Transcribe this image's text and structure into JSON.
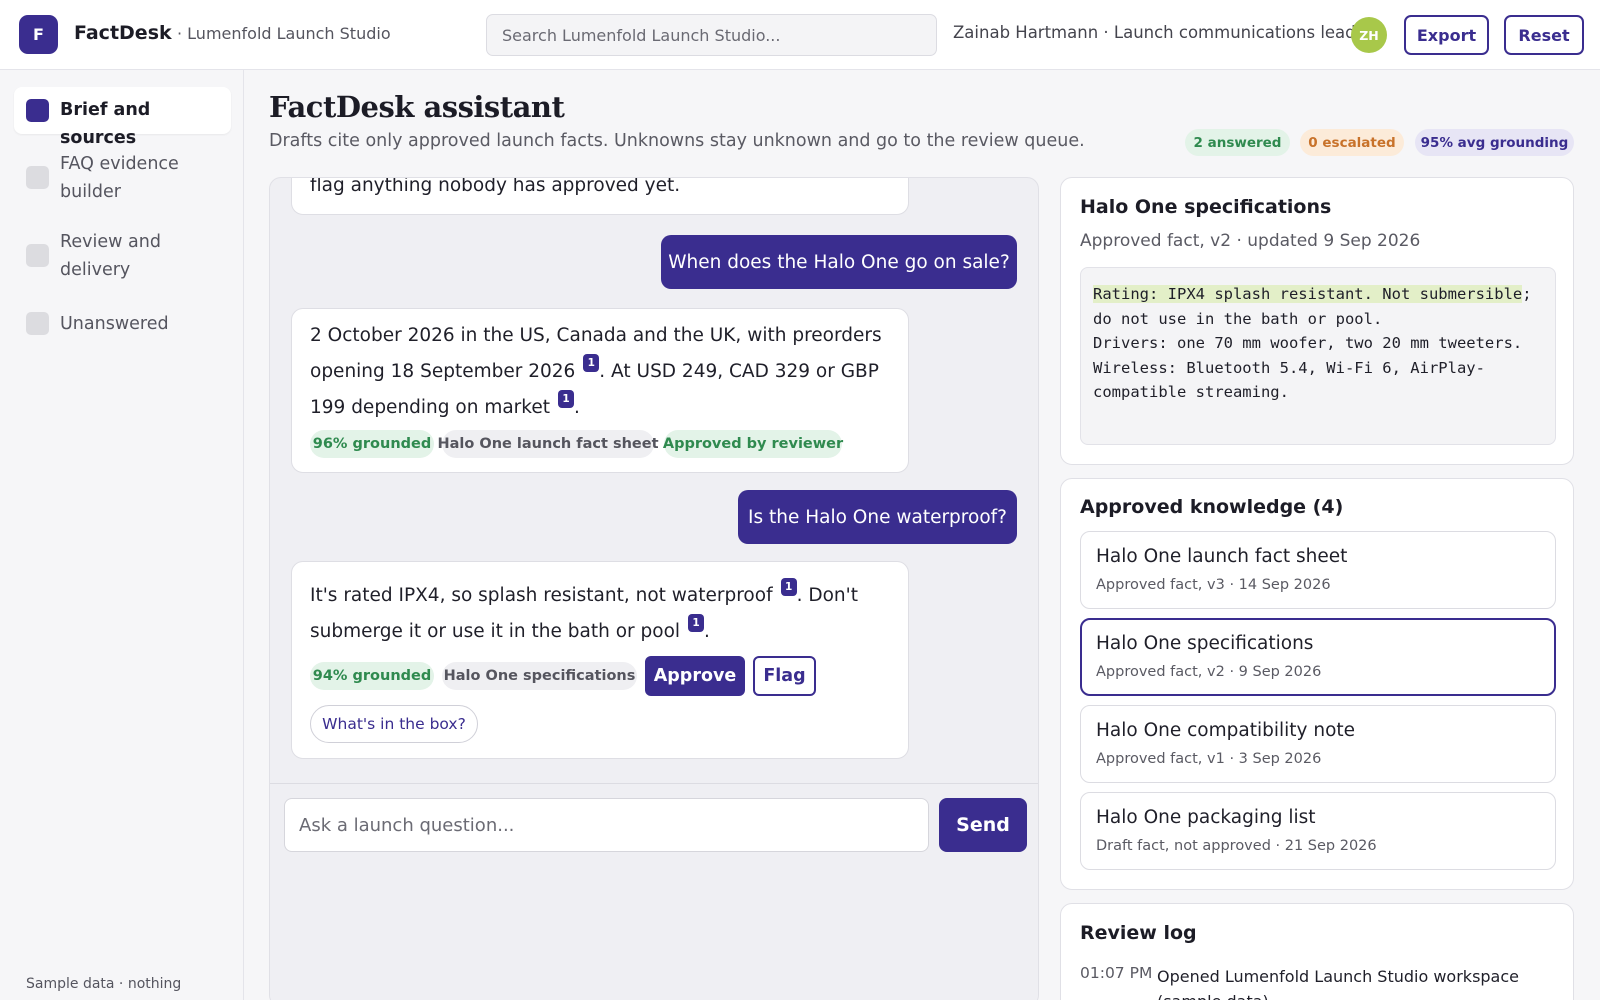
{
  "header": {
    "logo_letter": "F",
    "app_name": "FactDesk",
    "workspace": "· Lumenfold Launch Studio",
    "search_placeholder": "Search Lumenfold Launch Studio...",
    "user": "Zainab Hartmann · Launch communications lead",
    "avatar_initials": "ZH",
    "export_label": "Export",
    "reset_label": "Reset"
  },
  "sidebar": {
    "items": [
      {
        "label": "Brief and sources",
        "active": true
      },
      {
        "label": "FAQ evidence builder",
        "active": false
      },
      {
        "label": "Review and delivery",
        "active": false
      },
      {
        "label": "Unanswered",
        "active": false
      }
    ],
    "footer": "Sample data · nothing"
  },
  "main": {
    "title": "FactDesk assistant",
    "subtitle": "Drafts cite only approved launch facts. Unknowns stay unknown and go to the review queue.",
    "stats": {
      "answered": "2 answered",
      "escalated": "0 escalated",
      "grounding": "95% avg grounding"
    }
  },
  "chat": {
    "partial_text": "flag anything nobody has approved yet.",
    "q1": "When does the Halo One go on sale?",
    "a1": {
      "p1": "2 October 2026 in the US, Canada and the UK, with preorders opening 18 September 2026",
      "p2": ". At USD 249, CAD 329 or GBP 199 depending on market",
      "p3": ".",
      "cite1": "1",
      "cite2": "1",
      "grounded": "96% grounded",
      "source": "Halo One launch fact sheet",
      "status": "Approved by reviewer"
    },
    "q2": "Is the Halo One waterproof?",
    "a2": {
      "p1": "It's rated IPX4, so splash resistant, not waterproof",
      "p2": ". Don't submerge it or use it in the bath or pool",
      "p3": ".",
      "cite1": "1",
      "cite2": "1",
      "grounded": "94% grounded",
      "source": "Halo One specifications",
      "approve_label": "Approve",
      "flag_label": "Flag",
      "suggestion": "What's in the box?"
    },
    "input_placeholder": "Ask a launch question...",
    "send_label": "Send"
  },
  "spec_panel": {
    "title": "Halo One specifications",
    "meta": "Approved fact, v2 · updated 9 Sep 2026",
    "highlight": "Rating: IPX4 splash resistant. Not submersible",
    "body_rest": "; do not use in the bath or pool.\nDrivers: one 70 mm woofer, two 20 mm tweeters.\nWireless: Bluetooth 5.4, Wi-Fi 6, AirPlay-compatible streaming."
  },
  "knowledge": {
    "title": "Approved knowledge (4)",
    "items": [
      {
        "name": "Halo One launch fact sheet",
        "meta": "Approved fact, v3 · 14 Sep 2026",
        "selected": false
      },
      {
        "name": "Halo One specifications",
        "meta": "Approved fact, v2 · 9 Sep 2026",
        "selected": true
      },
      {
        "name": "Halo One compatibility note",
        "meta": "Approved fact, v1 · 3 Sep 2026",
        "selected": false
      },
      {
        "name": "Halo One packaging list",
        "meta": "Draft fact, not approved · 21 Sep 2026",
        "selected": false
      }
    ]
  },
  "review_log": {
    "title": "Review log",
    "entries": [
      {
        "time": "01:07 PM",
        "text": "Opened Lumenfold Launch Studio workspace (sample data)."
      }
    ]
  },
  "colors": {
    "accent": "#3a2d8f",
    "avatar": "#a8c84a",
    "green_text": "#2f8a4f",
    "green_bg": "#e3f3e8",
    "orange_text": "#c8722a",
    "orange_bg": "#fcebd9",
    "purple_bg": "#e7e5f5",
    "highlight": "#e3efc8"
  }
}
